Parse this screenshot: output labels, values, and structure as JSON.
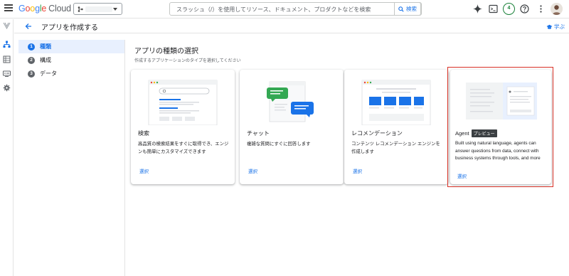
{
  "brand": {
    "google": [
      "G",
      "o",
      "o",
      "g",
      "l",
      "e"
    ],
    "cloud": "Cloud"
  },
  "search": {
    "placeholder": "スラッシュ（/）を使用してリソース、ドキュメント、プロダクトなどを検索",
    "button_label": "検索"
  },
  "topbar": {
    "notification_count": "4",
    "icons": [
      "gemini-sparkle-icon",
      "terminal-icon",
      "help-icon",
      "more-vert-icon"
    ]
  },
  "page": {
    "title": "アプリを作成する",
    "learn_label": "学ぶ"
  },
  "steps": [
    {
      "num": "1",
      "label": "種類"
    },
    {
      "num": "2",
      "label": "構成"
    },
    {
      "num": "3",
      "label": "データ"
    }
  ],
  "main": {
    "heading": "アプリの種類の選択",
    "subheading": "作成するアプリケーションのタイプを選択してください"
  },
  "cards": [
    {
      "title": "検索",
      "description": "高品質の検索結果をすぐに取得でき、エンジンも簡単にカスタマイズできます",
      "select_label": "選択"
    },
    {
      "title": "チャット",
      "description": "複雑な質問にすぐに回答します",
      "select_label": "選択"
    },
    {
      "title": "レコメンデーション",
      "description": "コンテンツ レコメンデーション エンジンを作成します",
      "select_label": "選択"
    },
    {
      "title": "Agent",
      "badge": "プレビュー",
      "description": "Built using natural language, agents can answer questions from data, connect with business systems through tools, and more",
      "select_label": "選択"
    }
  ],
  "colors": {
    "accent": "#1a73e8",
    "selection_outline": "#d93025",
    "chat_bubble_green": "#34a853",
    "chat_bubble_blue": "#1a73e8"
  }
}
